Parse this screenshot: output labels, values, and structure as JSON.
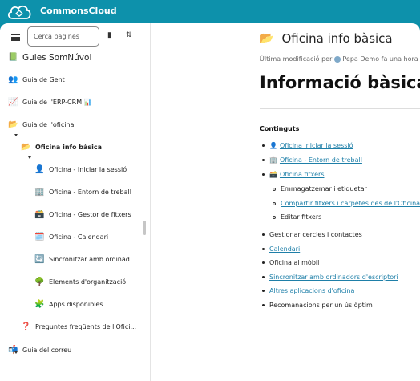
{
  "app": {
    "name": "CommonsCloud"
  },
  "sidebar": {
    "search_placeholder": "Cerca pagines",
    "book_title": "Guies SomNúvol",
    "items": [
      {
        "label": "Guia de Gent",
        "icon": "👥"
      },
      {
        "label": "Guia de l'ERP-CRM 📊",
        "icon": "📈"
      },
      {
        "label": "Guia de l'oficina",
        "icon": "📂"
      },
      {
        "label": "Oficina info bàsica",
        "icon": "📂"
      },
      {
        "label": "Oficina - Iniciar la sessió",
        "icon": "👤"
      },
      {
        "label": "Oficina - Entorn de treball",
        "icon": "🏢"
      },
      {
        "label": "Oficina - Gestor de fitxers",
        "icon": "🗃️"
      },
      {
        "label": "Oficina - Calendari",
        "icon": "🗓️"
      },
      {
        "label": "Sincronitzar amb ordinad...",
        "icon": "🔄"
      },
      {
        "label": "Elements d'organització",
        "icon": "🌳"
      },
      {
        "label": "Apps disponibles",
        "icon": "🧩"
      },
      {
        "label": "Preguntes freqüents de l'Ofici...",
        "icon": "❓"
      },
      {
        "label": "Guia del correu",
        "icon": "📬"
      }
    ]
  },
  "main": {
    "page_title": "Oficina info bàsica",
    "page_icon": "📂",
    "modified_prefix": "Última modificació per",
    "modified_user": "Pepa Demo",
    "modified_time": "fa una hora",
    "heading": "Informació bàsica de",
    "toc_title": "Continguts",
    "toc": [
      {
        "label": "Oficina iniciar la sessió",
        "emoji": "👤"
      },
      {
        "label": "Oficina - Entorn de treball",
        "emoji": "🏢"
      },
      {
        "label": "Oficina fitxers",
        "emoji": "🗃️"
      },
      {
        "label": "Emmagatzemar i etiquetar"
      },
      {
        "label": "Compartir fitxers i carpetes des de l'Oficina C"
      },
      {
        "label": "Editar fitxers"
      },
      {
        "label": "Gestionar cercles i contactes"
      },
      {
        "label": "Calendari"
      },
      {
        "label": "Oficina al mòbil"
      },
      {
        "label": "Sincronitzar amb ordinadors d'escriptori"
      },
      {
        "label": "Altres aplicacions d'oficina"
      },
      {
        "label": "Recomanacions per un ús òptim"
      }
    ]
  }
}
